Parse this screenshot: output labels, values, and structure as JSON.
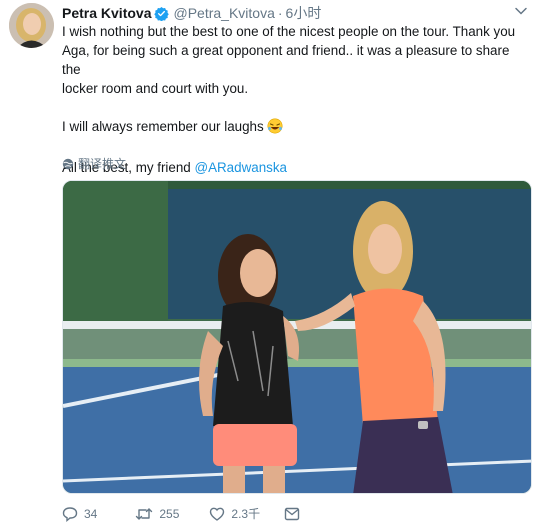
{
  "tweet": {
    "display_name": "Petra Kvitova",
    "handle": "@Petra_Kvitova",
    "separator": "·",
    "time": "6小时",
    "line1": "I wish nothing but the best to one of the nicest people on the tour. Thank you",
    "line2": "Aga, for being such a great opponent and friend.. it was a pleasure to share the",
    "line3": "locker room and court with you.",
    "line4": "I will always remember our laughs",
    "line5_prefix": "All the best, my friend ",
    "mention": "@ARadwanska",
    "translate_label": "翻译推文"
  },
  "actions": {
    "reply_count": "34",
    "retweet_count": "255",
    "like_count": "2.3千"
  },
  "colors": {
    "link": "#1b95e0",
    "muted": "#657786",
    "verified": "#1da1f2"
  },
  "icons": [
    "verified-badge-icon",
    "chevron-down-icon",
    "globe-icon",
    "laughing-emoji-icon",
    "reply-icon",
    "retweet-icon",
    "like-icon",
    "message-icon"
  ]
}
